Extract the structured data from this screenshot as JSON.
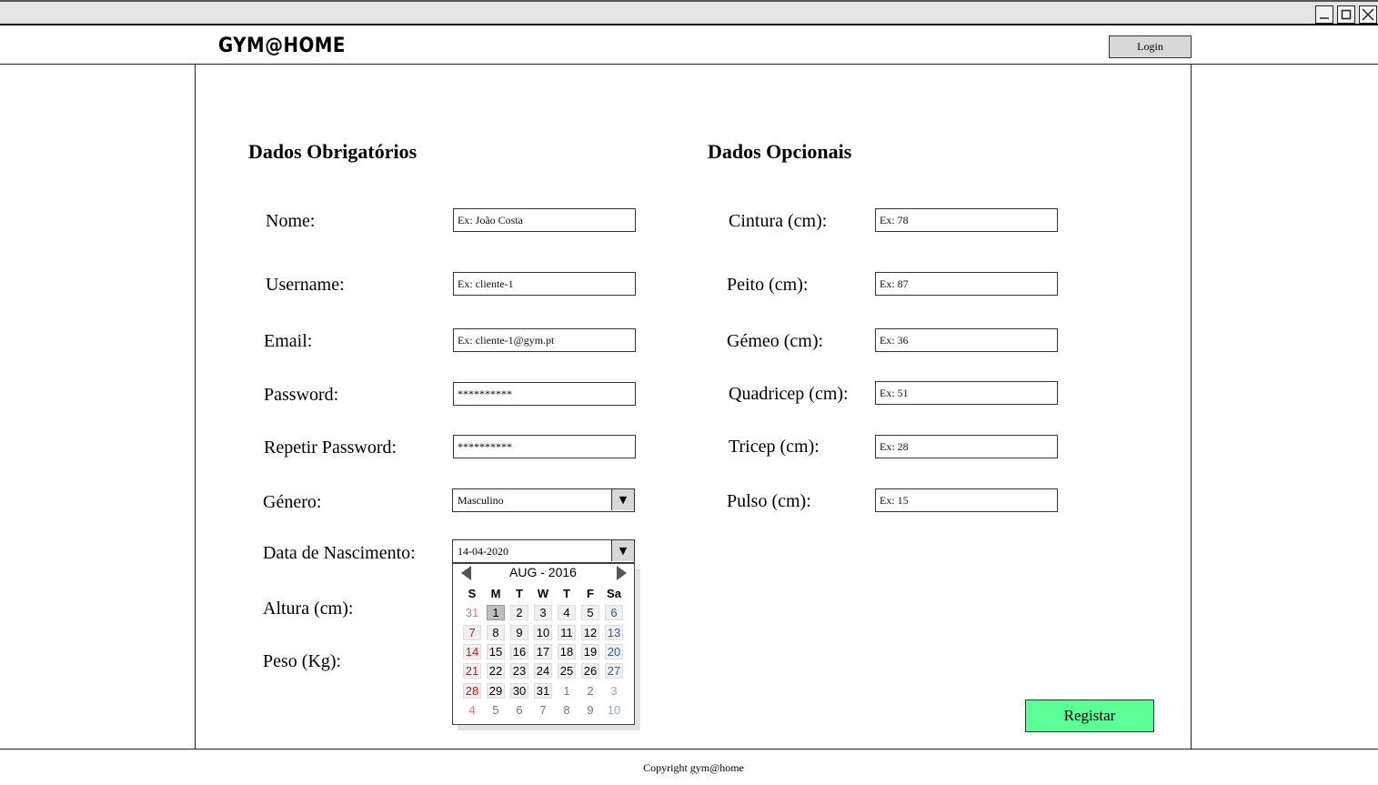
{
  "header": {
    "logo": "GYM@HOME",
    "login_label": "Login"
  },
  "window_controls": {
    "minimize": "minimize-icon",
    "maximize": "maximize-icon",
    "close": "close-icon"
  },
  "required": {
    "title": "Dados Obrigatórios",
    "fields": {
      "nome": {
        "label": "Nome:",
        "placeholder": "Ex: João Costa"
      },
      "username": {
        "label": "Username:",
        "placeholder": "Ex: cliente-1"
      },
      "email": {
        "label": "Email:",
        "placeholder": "Ex: cliente-1@gym.pt"
      },
      "password": {
        "label": "Password:",
        "value": "**********"
      },
      "repeat_password": {
        "label": "Repetir Password:",
        "value": "**********"
      },
      "genero": {
        "label": "Género:",
        "value": "Masculino"
      },
      "data_nascimento": {
        "label": "Data de Nascimento:",
        "value": "14-04-2020"
      },
      "altura": {
        "label": "Altura (cm):"
      },
      "peso": {
        "label": "Peso (Kg):"
      }
    }
  },
  "optional": {
    "title": "Dados Opcionais",
    "fields": {
      "cintura": {
        "label": "Cintura (cm):",
        "placeholder": "Ex: 78"
      },
      "peito": {
        "label": "Peito (cm):",
        "placeholder": "Ex: 87"
      },
      "gemeo": {
        "label": "Gémeo (cm):",
        "placeholder": "Ex: 36"
      },
      "quadricep": {
        "label": "Quadricep (cm):",
        "placeholder": "Ex: 51"
      },
      "tricep": {
        "label": "Tricep (cm):",
        "placeholder": "Ex: 28"
      },
      "pulso": {
        "label": "Pulso (cm):",
        "placeholder": "Ex: 15"
      }
    }
  },
  "calendar": {
    "title": "AUG - 2016",
    "weekdays": [
      "S",
      "M",
      "T",
      "W",
      "T",
      "F",
      "Sa"
    ],
    "selected": "1",
    "weeks": [
      [
        "31",
        "1",
        "2",
        "3",
        "4",
        "5",
        "6"
      ],
      [
        "7",
        "8",
        "9",
        "10",
        "11",
        "12",
        "13"
      ],
      [
        "14",
        "15",
        "16",
        "17",
        "18",
        "19",
        "20"
      ],
      [
        "21",
        "22",
        "23",
        "24",
        "25",
        "26",
        "27"
      ],
      [
        "28",
        "29",
        "30",
        "31",
        "1",
        "2",
        "3"
      ],
      [
        "4",
        "5",
        "6",
        "7",
        "8",
        "9",
        "10"
      ]
    ],
    "colors": {
      "sunday": "#c91a1a",
      "saturday": "#2d5bb0"
    }
  },
  "register_label": "Registar",
  "footer": {
    "copyright": "Copyright gym@home"
  },
  "colors": {
    "register_button": "#5cff96",
    "login_button": "#d8d8d8"
  }
}
